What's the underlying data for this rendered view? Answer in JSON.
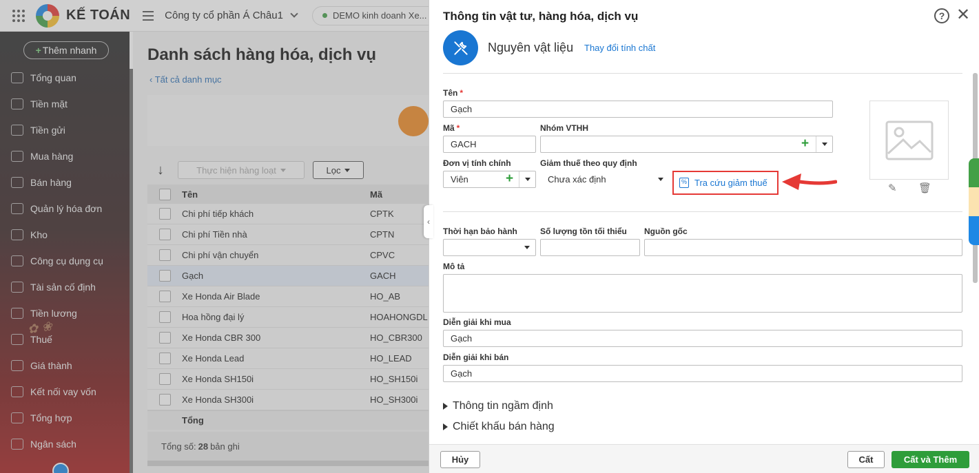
{
  "app": {
    "brand": "KẾ TOÁN",
    "company": "Công ty cổ phần Á Châu1",
    "demo_label": "DEMO kinh doanh Xe..."
  },
  "sidebar": {
    "quick_add": "Thêm nhanh",
    "items": [
      {
        "label": "Tổng quan",
        "icon": "chart-icon"
      },
      {
        "label": "Tiền mặt",
        "icon": "money-bag-icon"
      },
      {
        "label": "Tiền gửi",
        "icon": "bank-icon"
      },
      {
        "label": "Mua hàng",
        "icon": "shopping-bag-icon"
      },
      {
        "label": "Bán hàng",
        "icon": "cart-icon"
      },
      {
        "label": "Quản lý hóa đơn",
        "icon": "invoice-icon"
      },
      {
        "label": "Kho",
        "icon": "warehouse-icon"
      },
      {
        "label": "Công cụ dụng cụ",
        "icon": "tools-icon"
      },
      {
        "label": "Tài sản cố định",
        "icon": "asset-icon"
      },
      {
        "label": "Tiền lương",
        "icon": "salary-icon"
      },
      {
        "label": "Thuế",
        "icon": "tax-icon"
      },
      {
        "label": "Giá thành",
        "icon": "cost-icon"
      },
      {
        "label": "Kết nối vay vốn",
        "icon": "loan-icon"
      },
      {
        "label": "Tổng hợp",
        "icon": "report-icon"
      },
      {
        "label": "Ngân sách",
        "icon": "budget-icon"
      }
    ]
  },
  "main": {
    "title": "Danh sách hàng hóa, dịch vụ",
    "back_link": "Tất cả danh mục",
    "bulk_action": "Thực hiện hàng loạt",
    "filter": "Lọc",
    "columns": {
      "name": "Tên",
      "code": "Mã"
    },
    "rows": [
      {
        "name": "Chi phí tiếp khách",
        "code": "CPTK"
      },
      {
        "name": "Chi phí Tiền nhà",
        "code": "CPTN"
      },
      {
        "name": "Chi phí vận chuyển",
        "code": "CPVC"
      },
      {
        "name": "Gạch",
        "code": "GACH"
      },
      {
        "name": "Xe Honda Air Blade",
        "code": "HO_AB"
      },
      {
        "name": "Hoa hồng đại lý",
        "code": "HOAHONGDL"
      },
      {
        "name": "Xe Honda CBR 300",
        "code": "HO_CBR300"
      },
      {
        "name": "Xe Honda Lead",
        "code": "HO_LEAD"
      },
      {
        "name": "Xe Honda SH150i",
        "code": "HO_SH150i"
      },
      {
        "name": "Xe Honda SH300i",
        "code": "HO_SH300i"
      }
    ],
    "total_label": "Tổng",
    "count_prefix": "Tổng số:",
    "count_value": "28",
    "count_suffix": "bản ghi"
  },
  "panel": {
    "title": "Thông tin vật tư, hàng hóa, dịch vụ",
    "type_label": "Nguyên vật liệu",
    "change_type": "Thay đổi tính chất",
    "fields": {
      "name_label": "Tên",
      "name_value": "Gạch",
      "code_label": "Mã",
      "code_value": "GACH",
      "group_label": "Nhóm VTHH",
      "group_value": "",
      "unit_label": "Đơn vị tính chính",
      "unit_value": "Viên",
      "tax_reduce_label": "Giảm thuế theo quy định",
      "tax_reduce_value": "Chưa xác định",
      "tax_lookup": "Tra cứu giảm thuế",
      "warranty_label": "Thời hạn bảo hành",
      "warranty_value": "",
      "min_stock_label": "Số lượng tồn tối thiểu",
      "min_stock_value": "",
      "origin_label": "Nguồn gốc",
      "origin_value": "",
      "desc_label": "Mô tả",
      "desc_value": "",
      "buy_desc_label": "Diễn giải khi mua",
      "buy_desc_value": "Gạch",
      "sell_desc_label": "Diễn giải khi bán",
      "sell_desc_value": "Gạch"
    },
    "sections": [
      "Thông tin ngầm định",
      "Chiết khấu bán hàng"
    ],
    "buttons": {
      "cancel": "Hủy",
      "save": "Cất",
      "save_add": "Cất và Thêm"
    }
  },
  "colors": {
    "accent": "#1976d2",
    "primary_button": "#2e9d3a",
    "highlight": "#e53935"
  }
}
